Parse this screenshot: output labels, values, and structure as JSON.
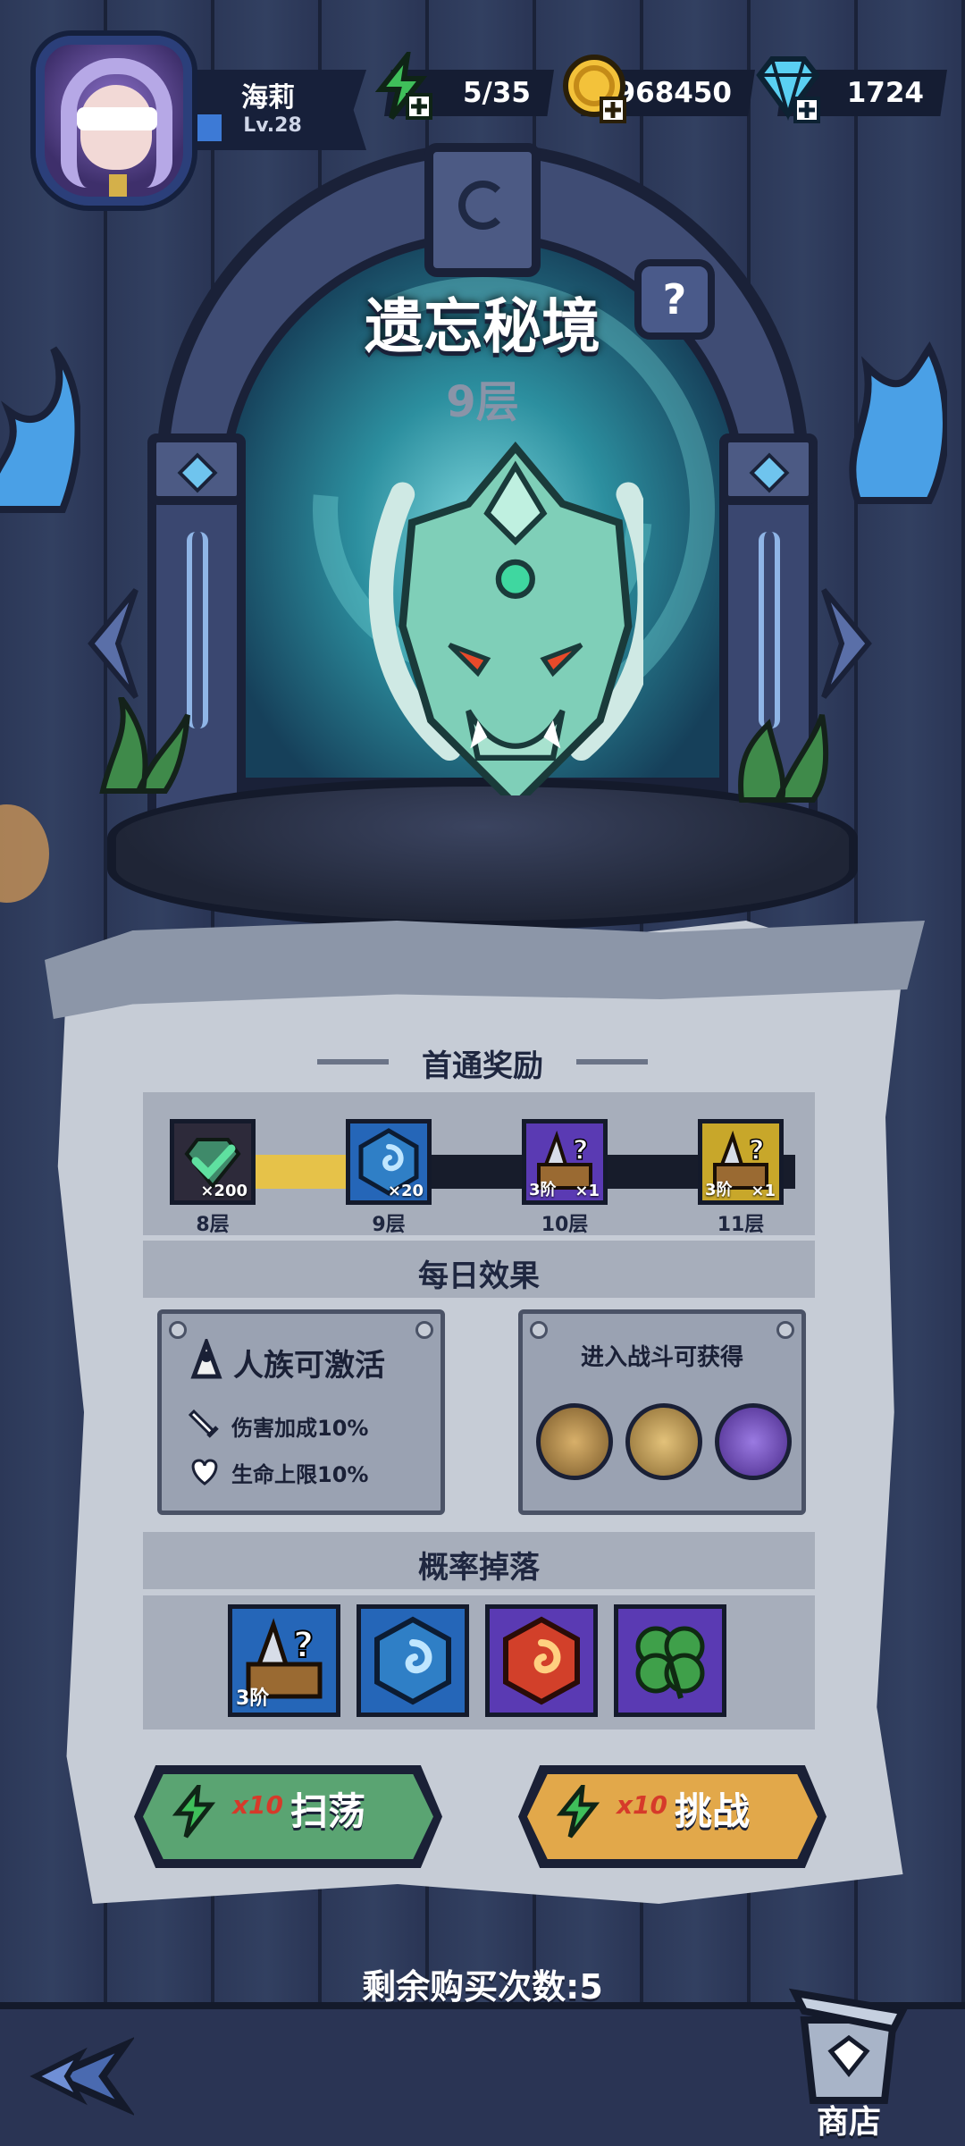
{
  "player": {
    "name": "海莉",
    "level": "Lv.28"
  },
  "resources": {
    "energy": "5/35",
    "gold": "968450",
    "gems": "1724"
  },
  "dungeon": {
    "title": "遗忘秘境",
    "floor": "9层",
    "help_label": "?"
  },
  "first_clear": {
    "title": "首通奖励",
    "rewards": [
      {
        "floor": "8层",
        "qty": "×200",
        "tier": "",
        "color": "#2d2a3a",
        "icon": "check-gem-icon"
      },
      {
        "floor": "9层",
        "qty": "×20",
        "tier": "",
        "color": "#2566b8",
        "icon": "blue-rune-icon"
      },
      {
        "floor": "10层",
        "qty": "×1",
        "tier": "3阶",
        "color": "#5a3ab3",
        "icon": "mystery-chest-icon"
      },
      {
        "floor": "11层",
        "qty": "×1",
        "tier": "3阶",
        "color": "#c8a72a",
        "icon": "mystery-chest-icon"
      }
    ]
  },
  "daily": {
    "title": "每日效果",
    "activation": "人族可激活",
    "stats": [
      "伤害加成10%",
      "生命上限10%"
    ],
    "battle_label": "进入战斗可获得",
    "abilities": [
      "claw-slash-icon",
      "rune-scroll-icon",
      "purple-crystal-icon"
    ]
  },
  "drops": {
    "title": "概率掉落",
    "items": [
      {
        "icon": "mystery-chest-icon",
        "tier": "3阶",
        "color": "#2566b8"
      },
      {
        "icon": "blue-rune-icon",
        "tier": "",
        "color": "#2566b8"
      },
      {
        "icon": "red-rune-icon",
        "tier": "",
        "color": "#5a3ab3"
      },
      {
        "icon": "clover-icon",
        "tier": "",
        "color": "#5a3ab3"
      }
    ]
  },
  "actions": {
    "sweep": {
      "multiplier": "x10",
      "label": "扫荡",
      "color": "#5aa472"
    },
    "challenge": {
      "multiplier": "x10",
      "label": "挑战",
      "color": "#e2a84a"
    }
  },
  "purchases": "剩余购买次数:5",
  "shop_label": "商店"
}
